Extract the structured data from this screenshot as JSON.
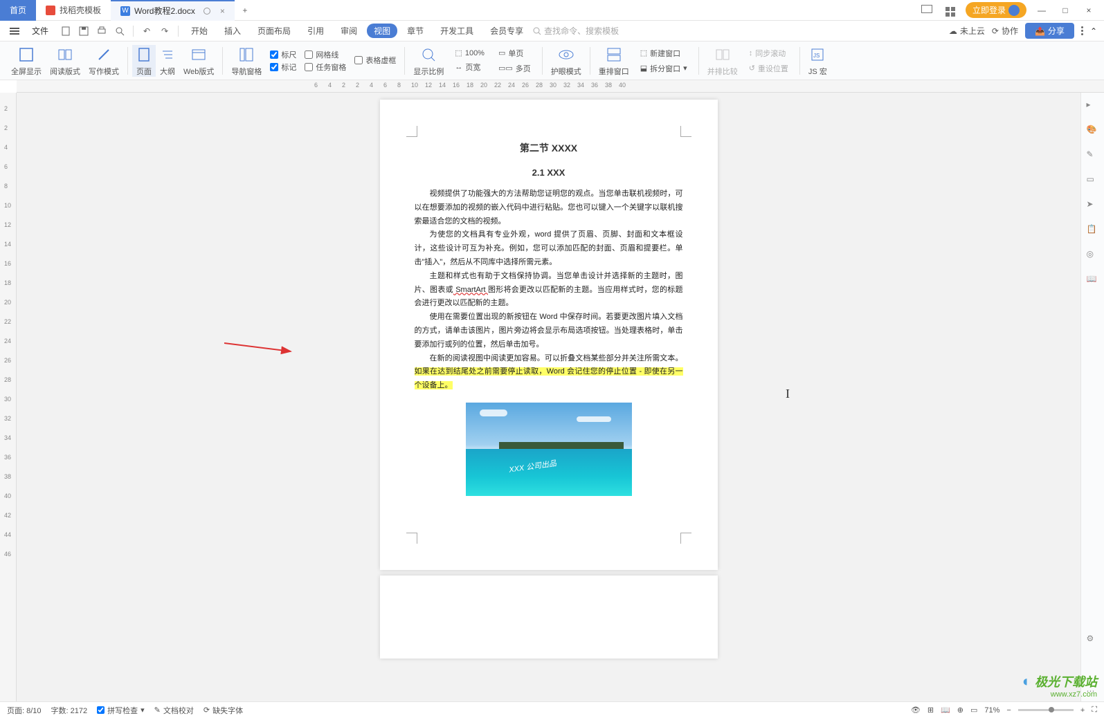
{
  "tabs": {
    "home": "首页",
    "template": "找稻壳模板",
    "doc": "Word教程2.docx"
  },
  "login_btn": "立即登录",
  "menubar": {
    "file": "文件",
    "items": [
      "开始",
      "插入",
      "页面布局",
      "引用",
      "审阅",
      "视图",
      "章节",
      "开发工具",
      "会员专享"
    ],
    "active_index": 5,
    "search_placeholder": "查找命令、搜索模板",
    "cloud": "未上云",
    "coop": "协作",
    "share": "分享"
  },
  "ribbon": {
    "fullscreen": "全屏显示",
    "read": "阅读版式",
    "write": "写作模式",
    "page": "页面",
    "outline": "大纲",
    "web": "Web版式",
    "nav": "导航窗格",
    "ruler": "标尺",
    "gridlines": "网格线",
    "tablegrid": "表格虚框",
    "markup": "标记",
    "taskpane": "任务窗格",
    "ratio": "显示比例",
    "zoom100": "100%",
    "singlepage": "单页",
    "pagewidth": "页宽",
    "multipage": "多页",
    "eyecare": "护眼模式",
    "rearrange": "重排窗口",
    "newwindow": "新建窗口",
    "splitwindow": "拆分窗口",
    "sidebyside": "并排比较",
    "syncscroll": "同步滚动",
    "resetpos": "重设位置",
    "jsmacro": "JS 宏"
  },
  "ruler_h": [
    "6",
    "4",
    "2",
    "2",
    "4",
    "6",
    "8",
    "10",
    "12",
    "14",
    "16",
    "18",
    "20",
    "22",
    "24",
    "26",
    "28",
    "30",
    "32",
    "34",
    "36",
    "38",
    "40"
  ],
  "ruler_v": [
    "2",
    "2",
    "4",
    "6",
    "8",
    "10",
    "12",
    "14",
    "16",
    "18",
    "20",
    "22",
    "24",
    "26",
    "28",
    "30",
    "32",
    "34",
    "36",
    "38",
    "40",
    "42",
    "44",
    "46"
  ],
  "document": {
    "section_title": "第二节  XXXX",
    "subtitle": "2.1 XXX",
    "p1": "视频提供了功能强大的方法帮助您证明您的观点。当您单击联机视频时，可以在想要添加的视频的嵌入代码中进行粘贴。您也可以键入一个关键字以联机搜索最适合您的文档的视频。",
    "p2a": "为使您的文档具有专业外观，word 提供了页眉、页脚、封面和文本框设计，这些设计可互为补充。例如，您可以添加匹配的封面、页眉和提要栏。单击\"插入\"，然后从不同库中选择所需元素。",
    "p3a": "主题和样式也有助于文档保持协调。当您单击设计并选择新的主题时，图片、图表或",
    "p3_smartart": " SmartArt ",
    "p3b": "图形将会更改以匹配新的主题。当应用样式时，您的标题会进行更改以匹配新的主题。",
    "p4": "使用在需要位置出现的新按钮在 Word 中保存时间。若要更改图片填入文档的方式，请单击该图片，图片旁边将会显示布局选项按钮。当处理表格时，单击要添加行或列的位置，然后单击加号。",
    "p5a": "在新的阅读视图中阅读更加容易。可以折叠文档某些部分并关注所需文本。",
    "p5_hl": "如果在达到结尾处之前需要停止读取，Word 会记住您的停止位置 - 即使在另一个设备上。",
    "watermark": "XXX 公司出品"
  },
  "statusbar": {
    "page": "页面: 8/10",
    "words": "字数: 2172",
    "spell": "拼写检查",
    "proof": "文档校对",
    "font_missing": "缺失字体",
    "zoom": "71%"
  },
  "brand": {
    "name": "极光下载站",
    "url": "www.xz7.com"
  }
}
